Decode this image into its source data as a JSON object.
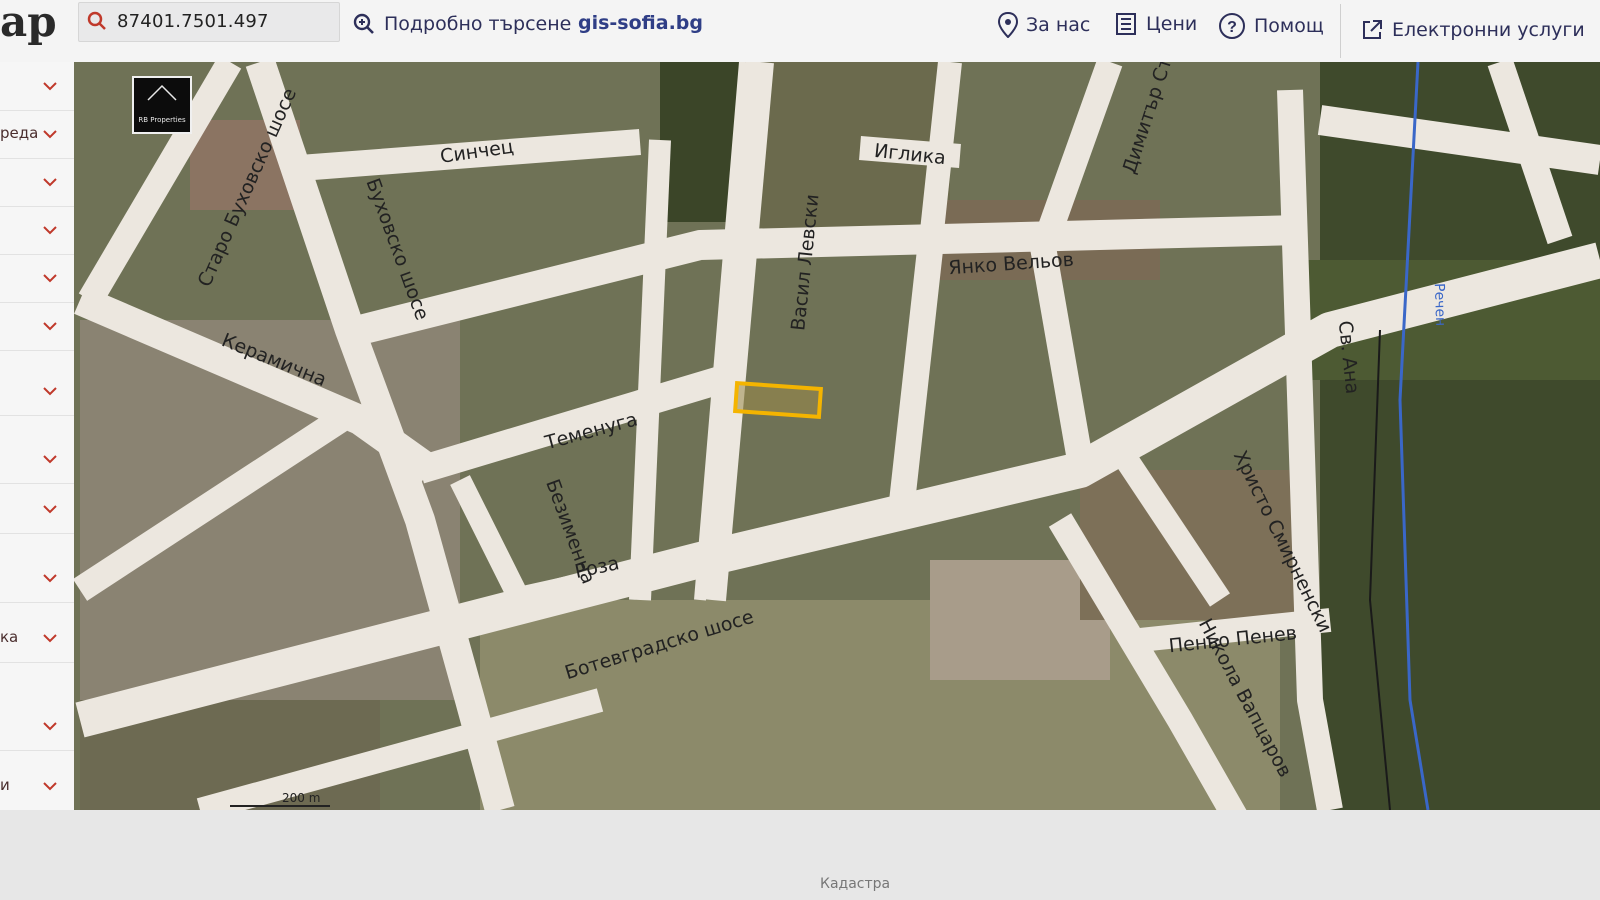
{
  "app": {
    "logo_text": "ap",
    "site_link": "gis-sofia.bg"
  },
  "search": {
    "value": "87401.7501.497"
  },
  "header": {
    "advanced_search": "Подробно търсене",
    "about": "За нас",
    "prices": "Цени",
    "help": "Помощ",
    "eservices": "Електронни услуги"
  },
  "sidebar": {
    "items": [
      {
        "label": ""
      },
      {
        "label": "реда"
      },
      {
        "label": ""
      },
      {
        "label": ""
      },
      {
        "label": ""
      },
      {
        "label": ""
      },
      {
        "label": ""
      },
      {
        "label": ""
      },
      {
        "label": ""
      },
      {
        "label": ""
      },
      {
        "label": "ка"
      },
      {
        "label": ""
      },
      {
        "label": "и"
      }
    ]
  },
  "map": {
    "scale_label": "200 m",
    "watermark": "RB Properties",
    "river_label": "Речен",
    "streets": {
      "sinchets": "Синчец",
      "iglika": "Иглика",
      "dimitar": "Димитър Сто",
      "yanko": "Янко Вельов",
      "levski": "Васил Левски",
      "buhovsko": "Буховско шосе",
      "staro_buhovsko": "Старо Буховско шосе",
      "keramichna": "Керамична",
      "temenuga": "Теменуга",
      "bezimenna": "Безименна",
      "roza": "Роза",
      "botevgradsko": "Ботевградско шосе",
      "sv_ana": "Св. Ана",
      "hristo": "Христо Смирненски",
      "penyo": "Пеньо Пенев",
      "nikola": "Никола Вапцаров"
    }
  },
  "colors": {
    "road": "#ece7df",
    "parcel": "#f4b400",
    "river": "#3a67c8",
    "accent": "#2f3e86"
  },
  "footer": {
    "text": "Кадастра"
  }
}
